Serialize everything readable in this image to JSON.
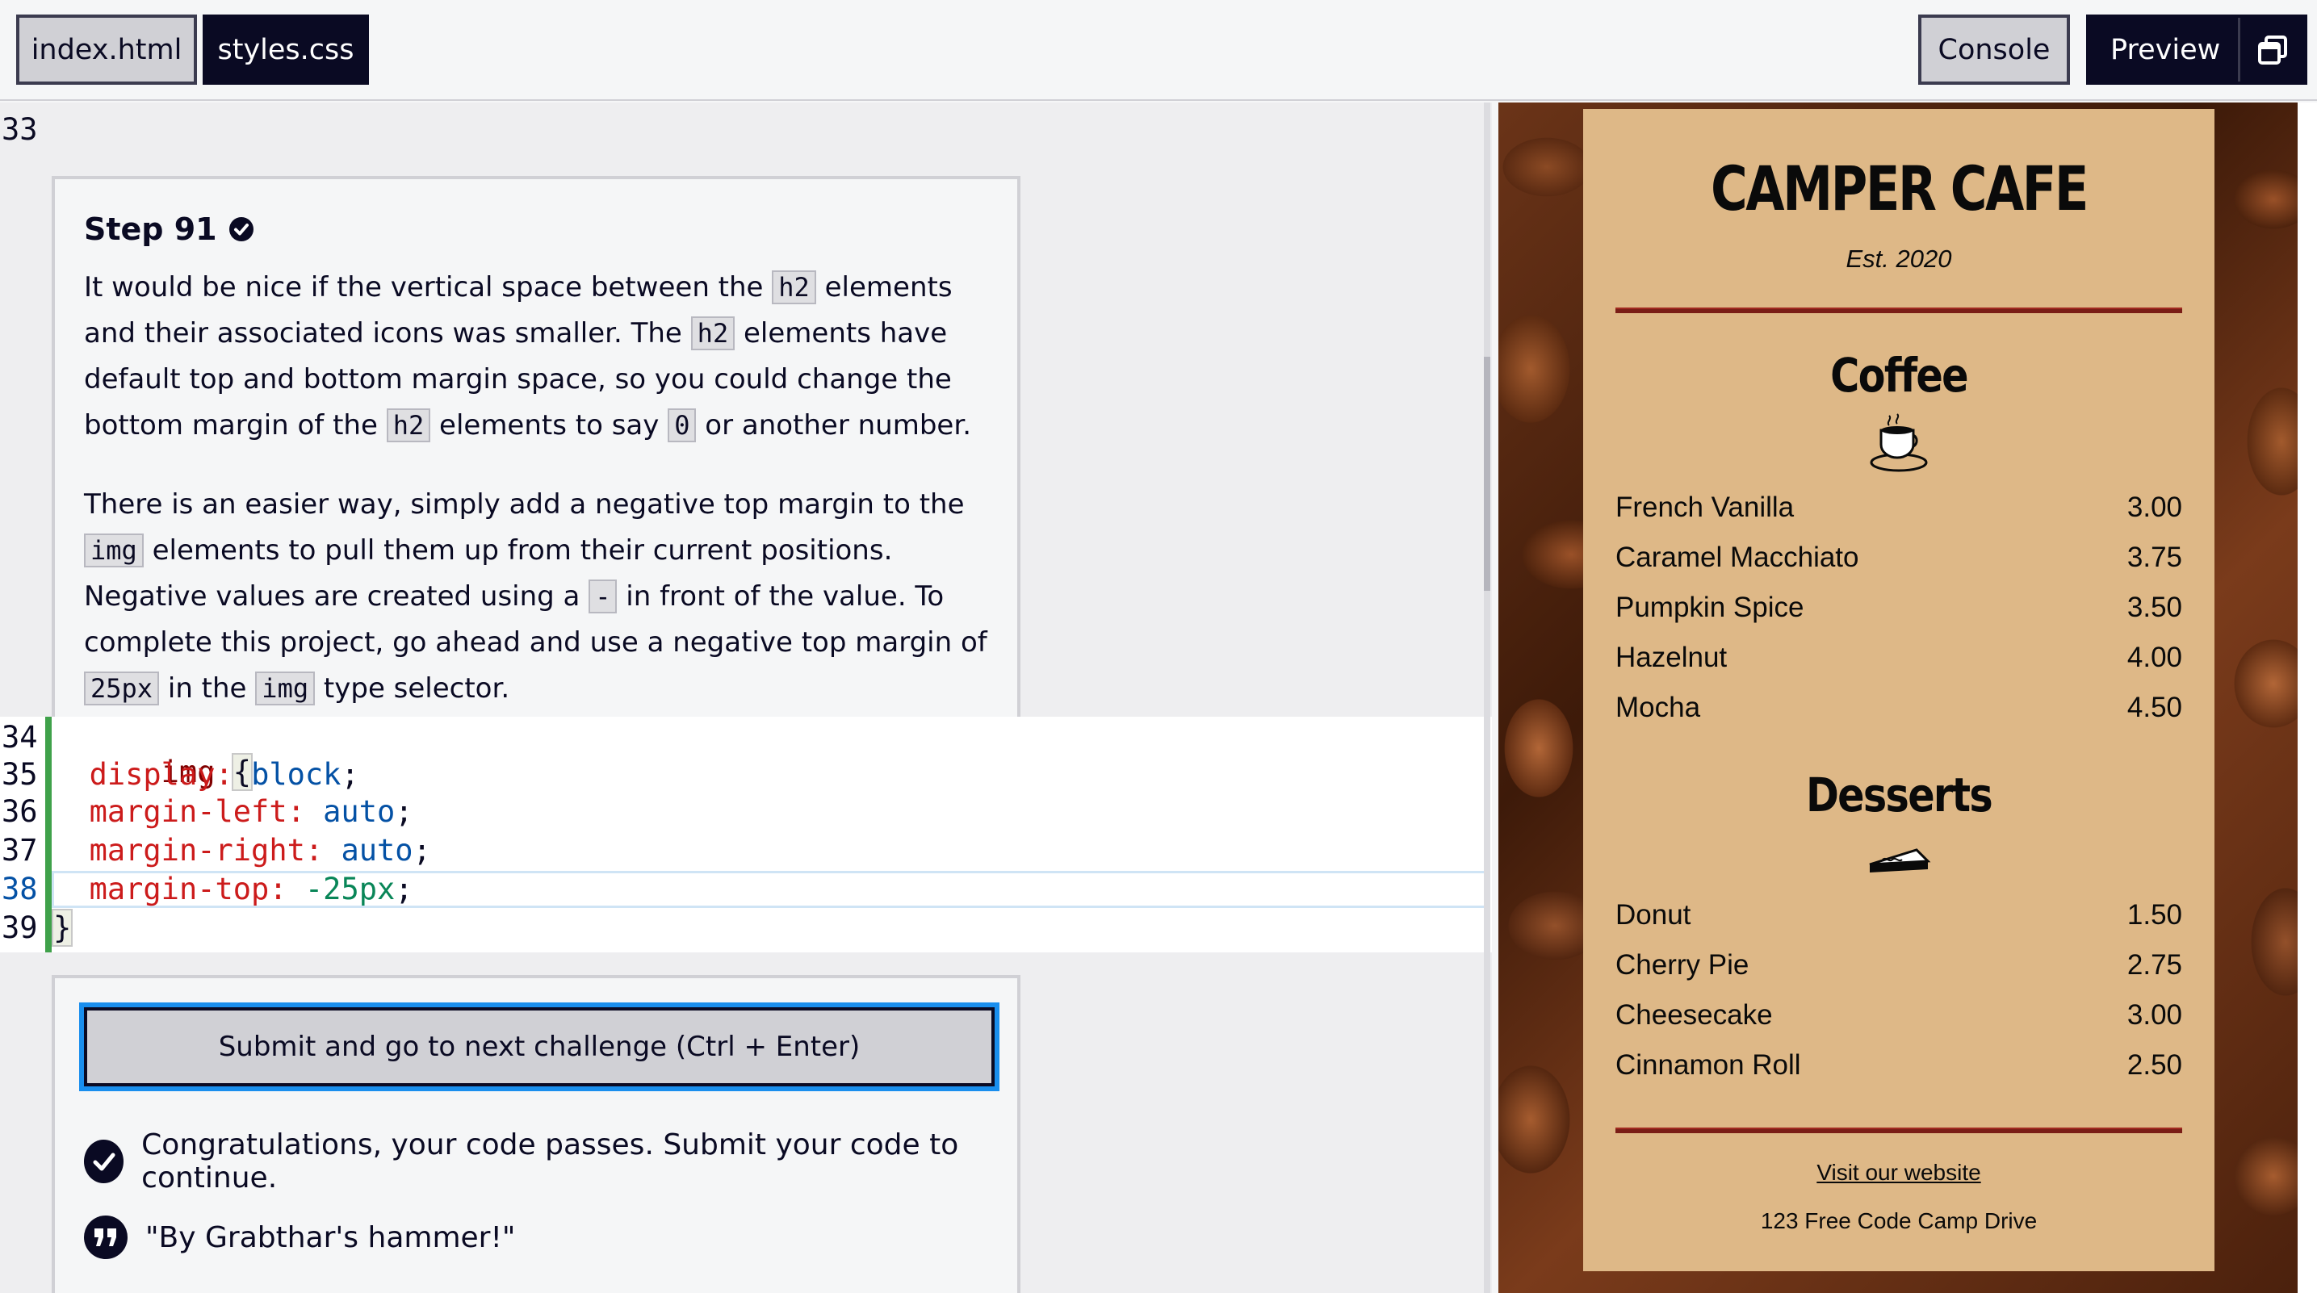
{
  "tabs": {
    "index": "index.html",
    "styles": "styles.css"
  },
  "buttons": {
    "console": "Console",
    "preview": "Preview"
  },
  "editor": {
    "top_line_number": "33",
    "step": {
      "title": "Step 91",
      "p1": {
        "t1": "It would be nice if the vertical space between the",
        "c1": "h2",
        "t2": "elements and their associated icons was smaller. The",
        "c2": "h2",
        "t3": "elements have default top and bottom margin space, so you could change the bottom margin of the",
        "c3": "h2",
        "t4": "elements to say",
        "c4": "0",
        "t5": "or another number."
      },
      "p2": {
        "t1": "There is an easier way, simply add a negative top margin to the",
        "c1": "img",
        "t2": "elements to pull them up from their current positions. Negative values are created using a",
        "c2": "-",
        "t3": "in front of the value. To complete this project, go ahead and use a negative top margin of",
        "c3": "25px",
        "t4": "in the",
        "c4": "img",
        "t5": "type selector."
      }
    },
    "code_lines": [
      {
        "num": "34",
        "sel": "img",
        "open": "{"
      },
      {
        "num": "35",
        "prop": "display:",
        "val": "block",
        "end": ";"
      },
      {
        "num": "36",
        "prop": "margin-left:",
        "val": "auto",
        "end": ";"
      },
      {
        "num": "37",
        "prop": "margin-right:",
        "val": "auto",
        "end": ";"
      },
      {
        "num": "38",
        "prop": "margin-top:",
        "val": "-25px",
        "end": ";"
      },
      {
        "num": "39",
        "close": "}"
      }
    ],
    "submit_label": "Submit and go to next challenge (Ctrl + Enter)",
    "success_message": "Congratulations, your code passes. Submit your code to continue.",
    "quote": "\"By Grabthar's hammer!\""
  },
  "preview": {
    "title": "CAMPER CAFE",
    "est": "Est. 2020",
    "coffee": {
      "heading": "Coffee",
      "icon": "coffee-cup-icon",
      "items": [
        {
          "name": "French Vanilla",
          "price": "3.00"
        },
        {
          "name": "Caramel Macchiato",
          "price": "3.75"
        },
        {
          "name": "Pumpkin Spice",
          "price": "3.50"
        },
        {
          "name": "Hazelnut",
          "price": "4.00"
        },
        {
          "name": "Mocha",
          "price": "4.50"
        }
      ]
    },
    "desserts": {
      "heading": "Desserts",
      "icon": "pie-slice-icon",
      "items": [
        {
          "name": "Donut",
          "price": "1.50"
        },
        {
          "name": "Cherry Pie",
          "price": "2.75"
        },
        {
          "name": "Cheesecake",
          "price": "3.00"
        },
        {
          "name": "Cinnamon Roll",
          "price": "2.50"
        }
      ]
    },
    "link": "Visit our website",
    "address": "123 Free Code Camp Drive"
  },
  "colors": {
    "accent": "#198eee",
    "dark": "#0a0a23",
    "menu_bg": "#deb887",
    "divider": "#7a1d16",
    "code_green": "#3fa14a"
  }
}
